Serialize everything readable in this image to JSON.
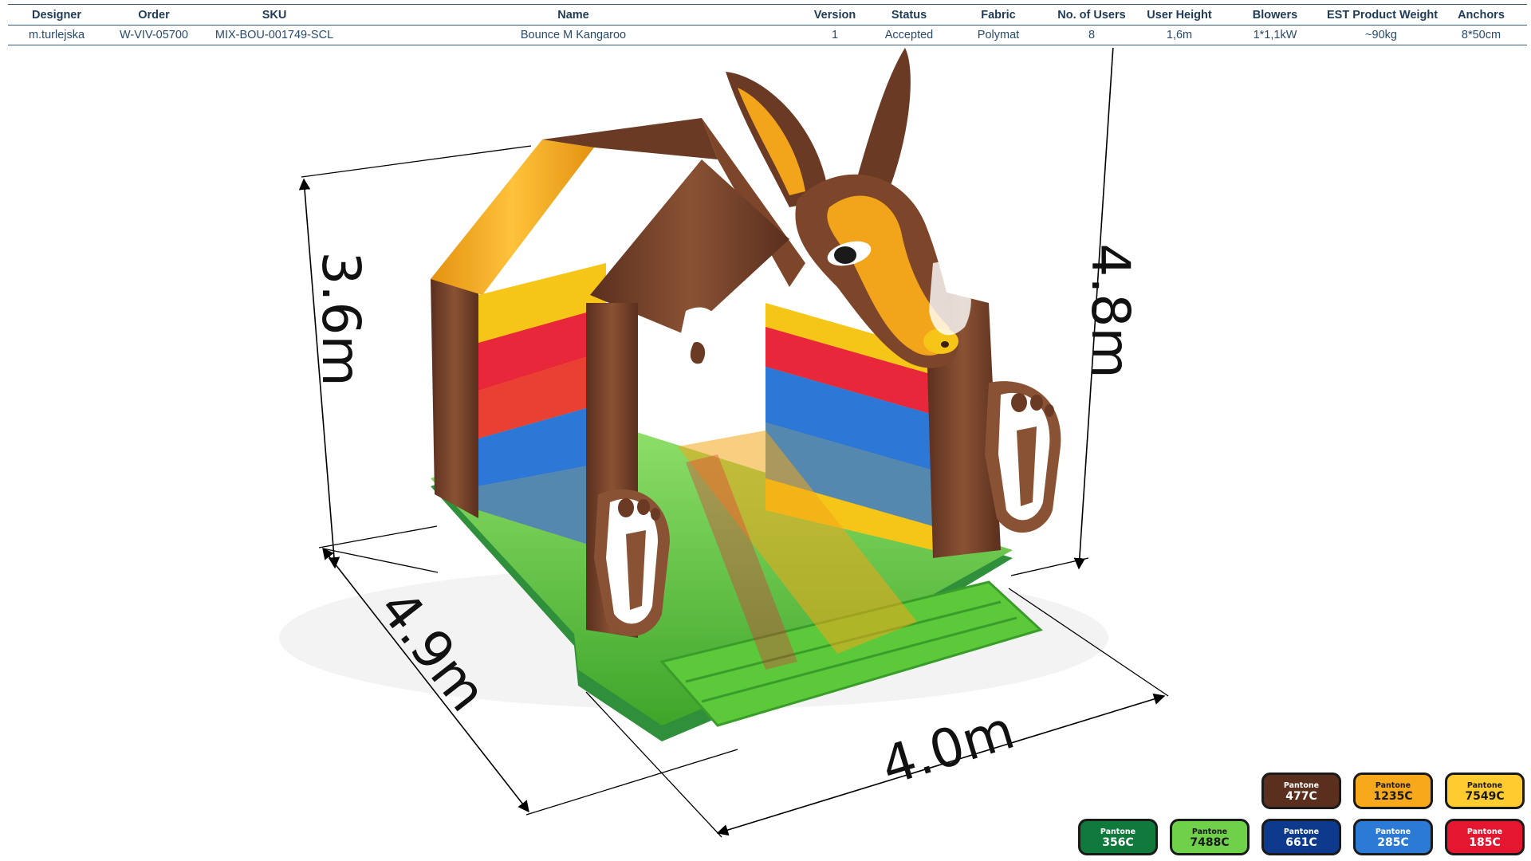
{
  "spec_table": {
    "headers": [
      "Designer",
      "Order",
      "SKU",
      "Name",
      "Version",
      "Status",
      "Fabric",
      "No. of Users",
      "User  Height",
      "Blowers",
      "EST Product Weight",
      "Anchors"
    ],
    "row": [
      "m.turlejska",
      "W-VIV-05700",
      "MIX-BOU-001749-SCL",
      "Bounce M Kangaroo",
      "1",
      "Accepted",
      "Polymat",
      "8",
      "1,6m",
      "1*1,1kW",
      "~90kg",
      "8*50cm"
    ]
  },
  "dimensions": {
    "height_front": "3.6m",
    "height_total": "4.8m",
    "depth": "4.9m",
    "width": "4.0m"
  },
  "product_render": {
    "description_colors": {
      "brown": "#6b3a24",
      "orange": "#f2a51a",
      "yellow": "#f5c518",
      "green": "#5cc93a",
      "dark_green": "#2f8f3a",
      "red": "#e8283a",
      "blue": "#2d78d6"
    }
  },
  "pantone": {
    "brand": "Pantone",
    "swatches": [
      {
        "code": "477C",
        "color": "#5a2f1e",
        "text": "dark"
      },
      {
        "code": "1235C",
        "color": "#f7a81b",
        "text": "light"
      },
      {
        "code": "7549C",
        "color": "#ffcb2f",
        "text": "light"
      },
      {
        "code": "356C",
        "color": "#0f7a3c",
        "text": "dark"
      },
      {
        "code": "7488C",
        "color": "#6fd14a",
        "text": "light"
      },
      {
        "code": "661C",
        "color": "#0d3a8c",
        "text": "dark"
      },
      {
        "code": "285C",
        "color": "#2b7bd6",
        "text": "dark"
      },
      {
        "code": "185C",
        "color": "#e5162f",
        "text": "dark"
      }
    ]
  }
}
